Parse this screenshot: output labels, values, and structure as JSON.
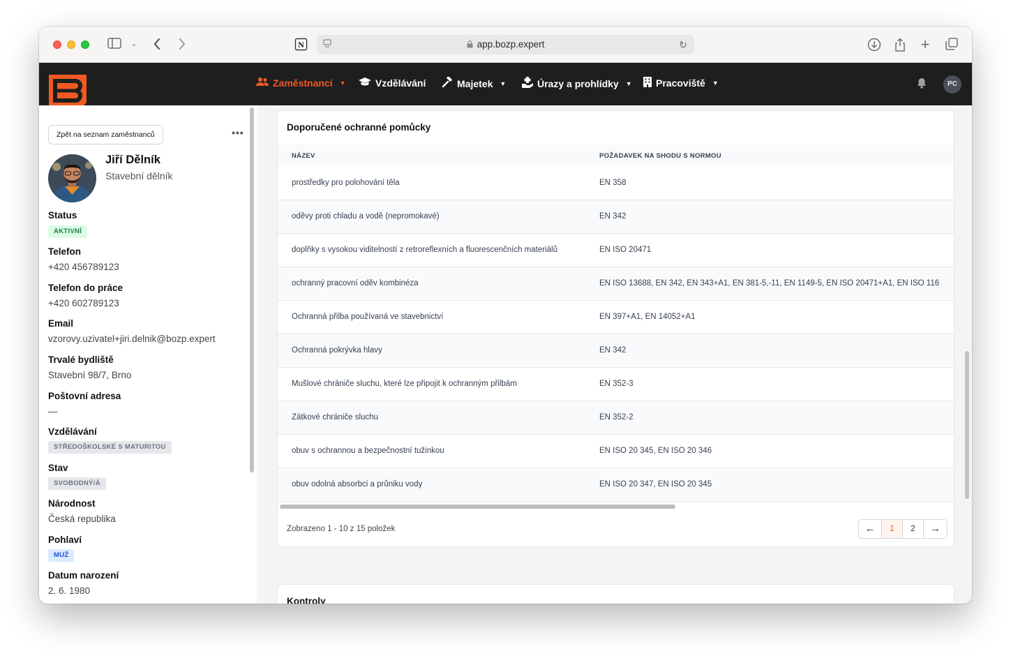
{
  "browser": {
    "url": "app.bozp.expert"
  },
  "nav": {
    "items": [
      {
        "label": "Zaměstnanci",
        "icon": "users-icon",
        "has_dropdown": true,
        "active": true
      },
      {
        "label": "Vzdělávání",
        "icon": "graduation-cap-icon",
        "has_dropdown": false,
        "active": false
      },
      {
        "label": "Majetek",
        "icon": "hammer-icon",
        "has_dropdown": true,
        "active": false
      },
      {
        "label": "Úrazy a prohlídky",
        "icon": "medical-icon",
        "has_dropdown": true,
        "active": false
      },
      {
        "label": "Pracoviště",
        "icon": "building-icon",
        "has_dropdown": true,
        "active": false
      }
    ],
    "user_initials": "PC"
  },
  "sidebar": {
    "back_label": "Zpět na seznam zaměstnanců",
    "more_label": "•••",
    "name": "Jiří Dělník",
    "role": "Stavební dělník",
    "fields": {
      "status_label": "Status",
      "status_value": "AKTIVNÍ",
      "phone_label": "Telefon",
      "phone_value": "+420 456789123",
      "work_phone_label": "Telefon do práce",
      "work_phone_value": "+420 602789123",
      "email_label": "Email",
      "email_value": "vzorovy.uzivatel+jiri.delnik@bozp.expert",
      "address_label": "Trvalé bydliště",
      "address_value": "Stavební 98/7, Brno",
      "postal_label": "Poštovní adresa",
      "postal_value": "—",
      "education_label": "Vzdělávání",
      "education_value": "STŘEDOŠKOLSKÉ S MATURITOU",
      "marital_label": "Stav",
      "marital_value": "SVOBODNÝ/Á",
      "nationality_label": "Národnost",
      "nationality_value": "Česká republika",
      "gender_label": "Pohlaví",
      "gender_value": "MUŽ",
      "birth_label": "Datum narození",
      "birth_value": "2. 6. 1980"
    }
  },
  "ppe_card": {
    "title": "Doporučené ochranné pomůcky",
    "columns": [
      "NÁZEV",
      "POŽADAVEK NA SHODU S NORMOU"
    ],
    "rows": [
      [
        "prostředky pro polohování těla",
        "EN 358"
      ],
      [
        "oděvy proti chladu a vodě (nepromokavé)",
        "EN 342"
      ],
      [
        "doplňky s vysokou viditelností z retroreflexních a fluorescenčních materiálů",
        "EN ISO 20471"
      ],
      [
        "ochranný pracovní oděv kombinéza",
        "EN ISO 13688, EN 342, EN 343+A1, EN 381-5,-11, EN 1149-5, EN ISO 20471+A1, EN ISO 116"
      ],
      [
        "Ochranná přilba používaná ve stavebnictví",
        "EN 397+A1, EN 14052+A1"
      ],
      [
        "Ochranná pokrývka hlavy",
        "EN 342"
      ],
      [
        "Mušlové chrániče sluchu, které lze připojit k ochranným přilbám",
        "EN 352-3"
      ],
      [
        "Zátkové chrániče sluchu",
        "EN 352-2"
      ],
      [
        "obuv s ochrannou a bezpečnostní tužinkou",
        "EN ISO 20 345, EN ISO 20 346"
      ],
      [
        "obuv odolná absorbci a průniku vody",
        "EN ISO 20 347, EN ISO 20 345"
      ]
    ],
    "summary": "Zobrazeno 1 - 10 z 15 položek",
    "pager": {
      "prev": "←",
      "pages": [
        "1",
        "2"
      ],
      "current": "1",
      "next": "→"
    }
  },
  "checks_card": {
    "title": "Kontroly"
  },
  "colors": {
    "accent": "#f05a22",
    "header_bg": "#1e1e1e"
  }
}
